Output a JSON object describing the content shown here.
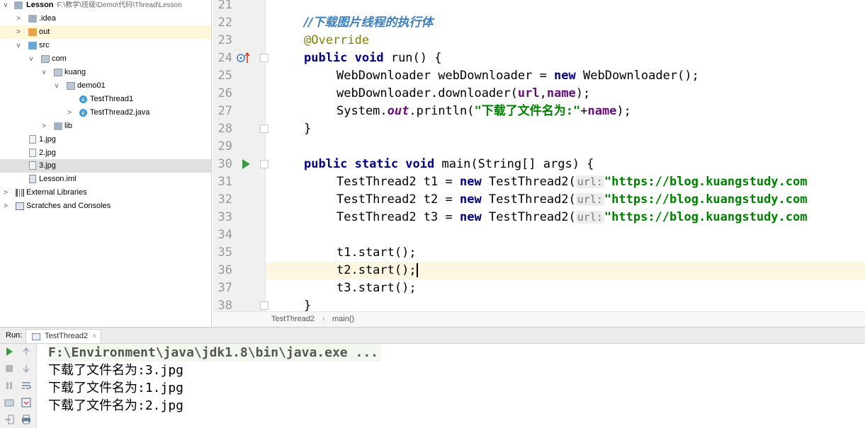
{
  "project": {
    "root": {
      "name": "Lesson",
      "path": "F:\\教学\\班级\\Demo\\代码\\Thread\\Lesson"
    },
    "items": [
      {
        "label": ".idea"
      },
      {
        "label": "out"
      },
      {
        "label": "src"
      },
      {
        "label": "com"
      },
      {
        "label": "kuang"
      },
      {
        "label": "demo01"
      },
      {
        "label": "TestThread1"
      },
      {
        "label": "TestThread2.java"
      },
      {
        "label": "lib"
      },
      {
        "label": "1.jpg"
      },
      {
        "label": "2.jpg"
      },
      {
        "label": "3.jpg"
      },
      {
        "label": "Lesson.iml"
      },
      {
        "label": "External Libraries"
      },
      {
        "label": "Scratches and Consoles"
      }
    ]
  },
  "editor": {
    "line_numbers": [
      "21",
      "22",
      "23",
      "24",
      "25",
      "26",
      "27",
      "28",
      "29",
      "30",
      "31",
      "32",
      "33",
      "34",
      "35",
      "36",
      "37",
      "38"
    ],
    "code": {
      "l22": "//下载图片线程的执行体",
      "l23": "@Override",
      "l24a": "public void",
      "l24b": " run() {",
      "l25a": "WebDownloader webDownloader = ",
      "l25b": "new",
      "l25c": " WebDownloader();",
      "l26a": "webDownloader.downloader(",
      "l26b": "url",
      "l26c": ",",
      "l26d": "name",
      "l26e": ");",
      "l27a": "System.",
      "l27b": "out",
      "l27c": ".println(",
      "l27d": "\"下载了文件名为:\"",
      "l27e": "+",
      "l27f": "name",
      "l27g": ");",
      "l28": "}",
      "l30a": "public static void",
      "l30b": " main(String[] args) {",
      "t_decl1": "TestThread2 t1 = ",
      "t_decl2": "TestThread2 t2 = ",
      "t_decl3": "TestThread2 t3 = ",
      "new": "new",
      "ctor": " TestThread2(",
      "hint": "url:",
      "url": "\"https://blog.kuangstudy.com",
      "l35": "t1.start();",
      "l36": "t2.start();",
      "l37": "t3.start();",
      "l38": "}"
    }
  },
  "breadcrumb": {
    "cls": "TestThread2",
    "sep": "›",
    "method": "main()"
  },
  "run": {
    "label": "Run:",
    "tab": "TestThread2",
    "close": "×",
    "console": [
      "F:\\Environment\\java\\jdk1.8\\bin\\java.exe ...",
      "下载了文件名为:3.jpg",
      "下载了文件名为:1.jpg",
      "下载了文件名为:2.jpg"
    ]
  }
}
